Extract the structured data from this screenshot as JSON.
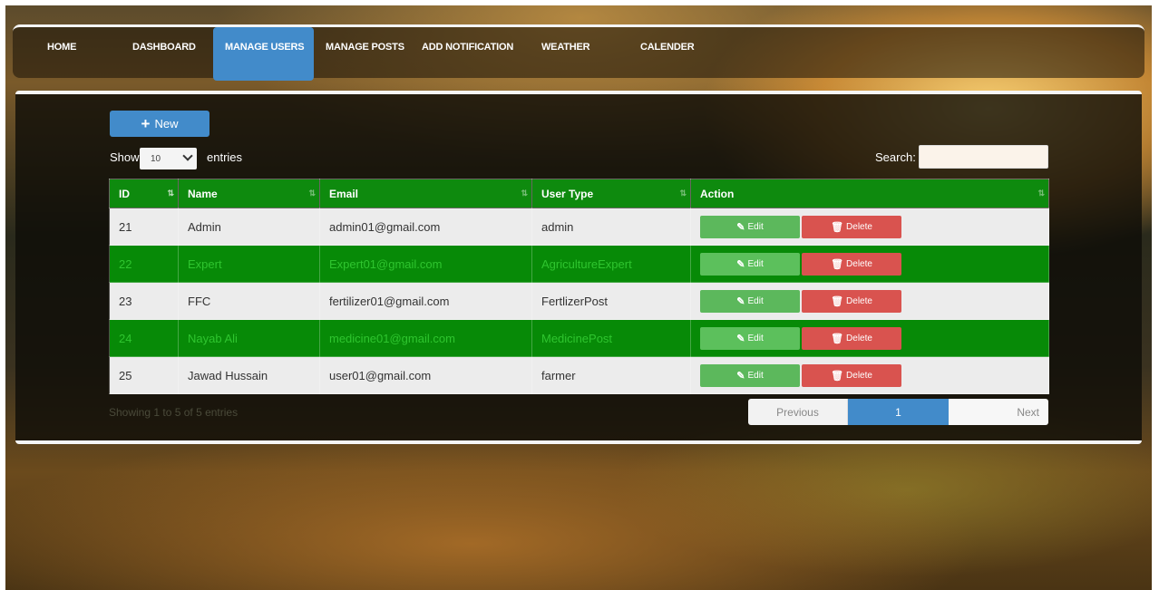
{
  "nav": {
    "items": [
      {
        "label": "HOME"
      },
      {
        "label": "DASHBOARD"
      },
      {
        "label": "MANAGE USERS",
        "active": true
      },
      {
        "label": "MANAGE POSTS"
      },
      {
        "label": "ADD NOTIFICATION"
      },
      {
        "label": "WEATHER"
      },
      {
        "label": "CALENDER"
      }
    ]
  },
  "toolbar": {
    "new_label": "New",
    "new_icon": "plus-icon"
  },
  "length": {
    "show_label": "Show",
    "value": "10",
    "entries_label": "entries"
  },
  "search": {
    "label": "Search:",
    "value": ""
  },
  "table": {
    "headers": [
      "ID",
      "Name",
      "Email",
      "User Type",
      "Action"
    ],
    "rows": [
      {
        "id": "21",
        "name": "Admin",
        "email": "admin01@gmail.com",
        "type": "admin"
      },
      {
        "id": "22",
        "name": "Expert",
        "email": "Expert01@gmail.com",
        "type": "AgricultureExpert"
      },
      {
        "id": "23",
        "name": "FFC",
        "email": "fertilizer01@gmail.com",
        "type": "FertlizerPost"
      },
      {
        "id": "24",
        "name": "Nayab Ali",
        "email": "medicine01@gmail.com",
        "type": "MedicinePost"
      },
      {
        "id": "25",
        "name": "Jawad Hussain",
        "email": "user01@gmail.com",
        "type": "farmer"
      }
    ],
    "edit_label": "Edit",
    "delete_label": "Delete"
  },
  "info": "Showing 1 to 5 of 5 entries",
  "pagination": {
    "previous": "Previous",
    "current": "1",
    "next": "Next"
  },
  "colors": {
    "accent": "#428bca",
    "header_green": "#0e8a0e",
    "row_green": "#078a07",
    "edit": "#5cb85c",
    "delete": "#d9534f"
  }
}
